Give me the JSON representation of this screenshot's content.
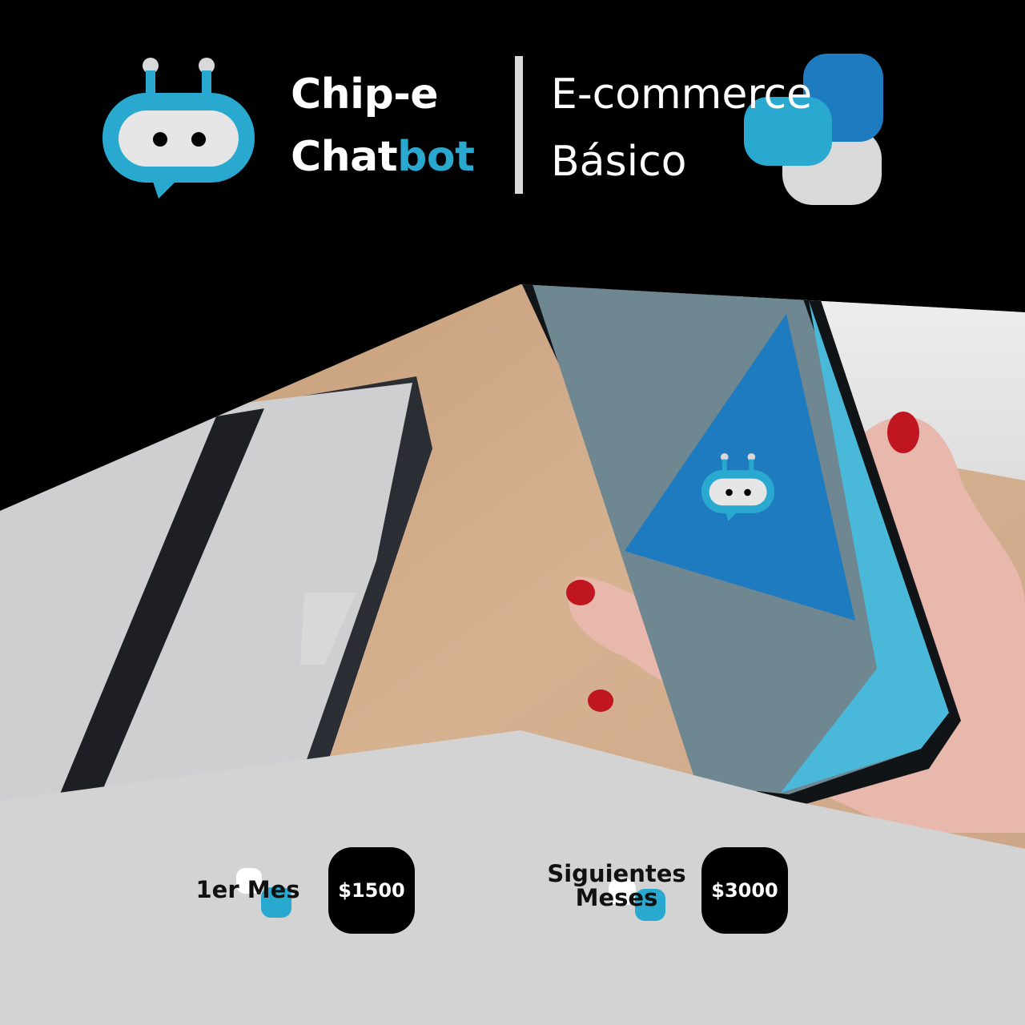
{
  "brand": {
    "name_line1": "Chip-e",
    "name_line2_part1": "Chat",
    "name_line2_part2": "bot",
    "logo_icon": "chatbot-robot-icon"
  },
  "plan": {
    "line1": "E-commerce",
    "line2": "Básico"
  },
  "colors": {
    "background": "#000000",
    "accent_light": "#29a9d0",
    "accent_dark": "#1e7bbf",
    "light_gray": "#d9d9d9",
    "panel_gray": "#d3d3d3",
    "phone_screen": "#6e8791"
  },
  "pricing": [
    {
      "label_lines": [
        "1er Mes"
      ],
      "price": "$1500"
    },
    {
      "label_lines": [
        "Siguientes",
        "Meses"
      ],
      "price": "$3000"
    }
  ]
}
